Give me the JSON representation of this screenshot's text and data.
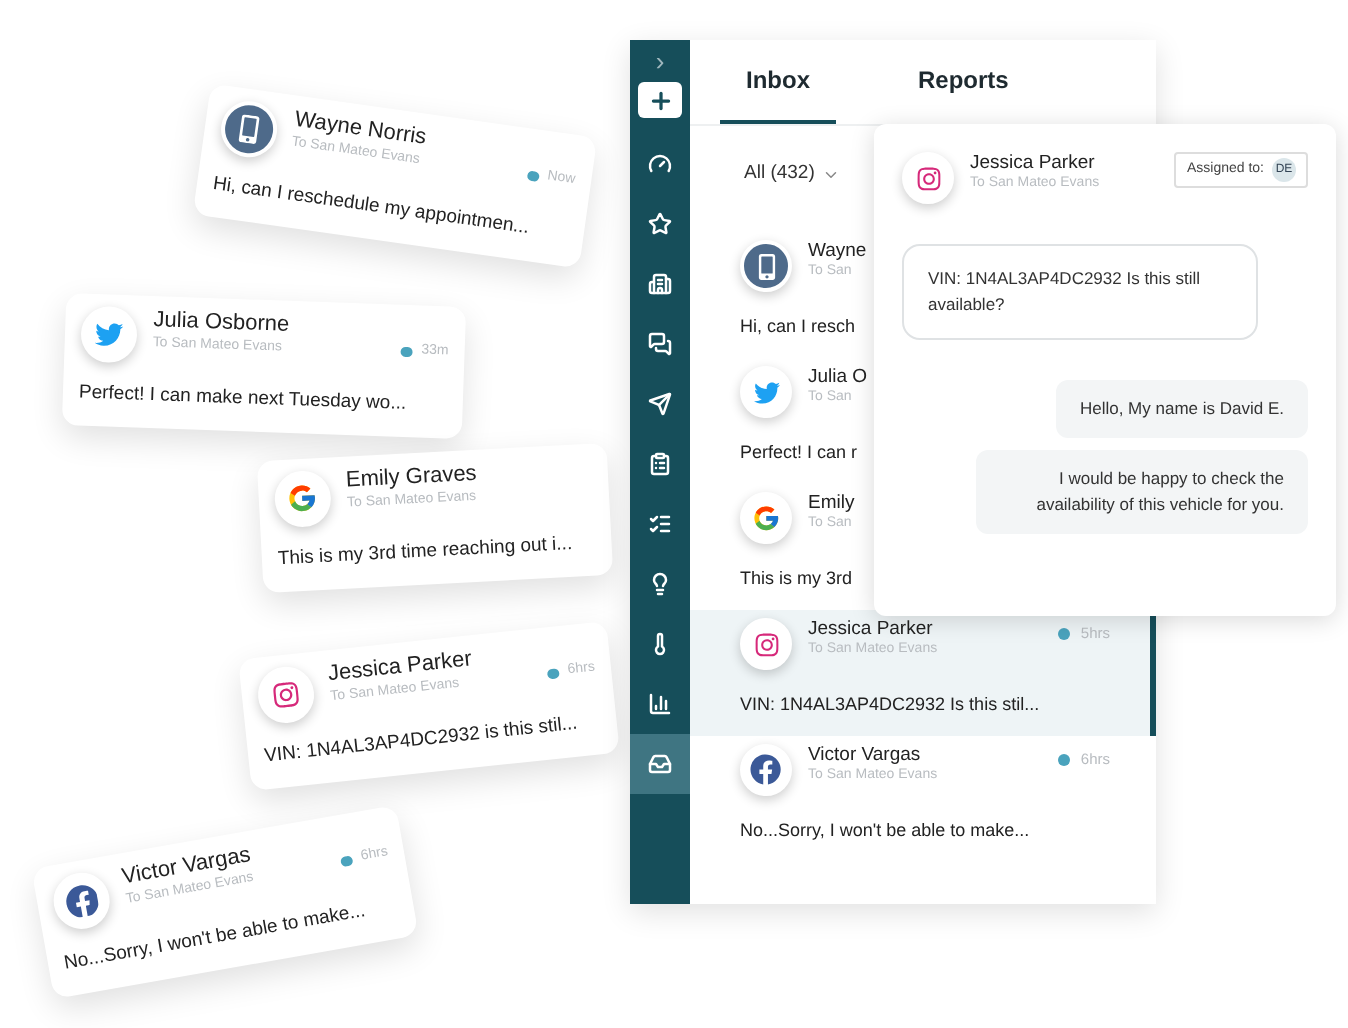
{
  "floating_cards": [
    {
      "kind": "phone",
      "name": "Wayne Norris",
      "subtitle": "To San Mateo Evans",
      "time": "Now",
      "message": "Hi, can I reschedule my appointmen..."
    },
    {
      "kind": "twitter",
      "name": "Julia Osborne",
      "subtitle": "To San Mateo Evans",
      "time": "33m",
      "message": "Perfect! I can make next Tuesday wo..."
    },
    {
      "kind": "google",
      "name": "Emily Graves",
      "subtitle": "To San Mateo Evans",
      "message": "This is my 3rd time reaching out i..."
    },
    {
      "kind": "instagram",
      "name": "Jessica Parker",
      "subtitle": "To San Mateo Evans",
      "time": "6hrs",
      "message": "VIN: 1N4AL3AP4DC2932 is this stil..."
    },
    {
      "kind": "facebook",
      "name": "Victor Vargas",
      "subtitle": "To San Mateo Evans",
      "time": "6hrs",
      "message": "No...Sorry, I won't be able to make..."
    }
  ],
  "sidebar": {
    "toggle": "›",
    "items": [
      {
        "kind": "add",
        "selected": false
      },
      {
        "kind": "gauge",
        "selected": false
      },
      {
        "kind": "star",
        "selected": false
      },
      {
        "kind": "building",
        "selected": false
      },
      {
        "kind": "chat",
        "selected": false
      },
      {
        "kind": "send",
        "selected": false
      },
      {
        "kind": "clipboard",
        "selected": false
      },
      {
        "kind": "list",
        "selected": false
      },
      {
        "kind": "bulb",
        "selected": false
      },
      {
        "kind": "thermometer",
        "selected": false
      },
      {
        "kind": "chart",
        "selected": false
      },
      {
        "kind": "inbox",
        "selected": true
      }
    ]
  },
  "tabs": [
    {
      "label": "Inbox",
      "selected": true
    },
    {
      "label": "Reports",
      "selected": false
    }
  ],
  "filter": "All (432)",
  "inbox": [
    {
      "kind": "phone",
      "name": "Wayne",
      "subtitle": "To San",
      "message": "Hi, can I resch",
      "selected": false
    },
    {
      "kind": "twitter",
      "name": "Julia O",
      "subtitle": "To San",
      "message": "Perfect! I can r",
      "selected": false
    },
    {
      "kind": "google",
      "name": "Emily",
      "subtitle": "To San",
      "message": "This is my 3rd",
      "selected": false
    },
    {
      "kind": "instagram",
      "name": "Jessica Parker",
      "subtitle": "To San Mateo Evans",
      "time": "5hrs",
      "message": "VIN: 1N4AL3AP4DC2932 Is this stil...",
      "selected": true
    },
    {
      "kind": "facebook",
      "name": "Victor Vargas",
      "subtitle": "To San Mateo Evans",
      "time": "6hrs",
      "message": "No...Sorry, I won't be able to make...",
      "selected": false
    }
  ],
  "chat": {
    "kind": "instagram",
    "name": "Jessica Parker",
    "subtitle": "To San Mateo Evans",
    "assigned_label": "Assigned to:",
    "assignee": "DE",
    "messages": [
      {
        "kind": "incoming",
        "text": "VIN: 1N4AL3AP4DC2932 Is this still available?"
      },
      {
        "kind": "outgoing",
        "text": "Hello, My name is David E."
      },
      {
        "kind": "outgoing",
        "text": "I would be happy to check the availability of this vehicle for you."
      }
    ]
  }
}
